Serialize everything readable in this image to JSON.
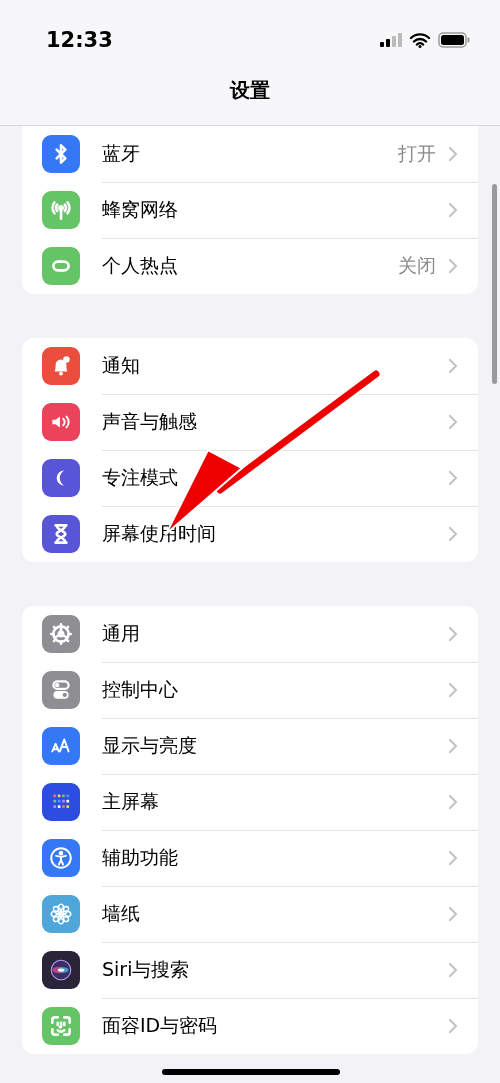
{
  "status_bar": {
    "time": "12:33"
  },
  "title": "设置",
  "sections": [
    {
      "rows": [
        {
          "label": "蓝牙",
          "value": "打开",
          "color": "#3478f6"
        },
        {
          "label": "蜂窝网络",
          "color": "#65c466"
        },
        {
          "label": "个人热点",
          "value": "关闭",
          "color": "#65c466"
        }
      ]
    },
    {
      "rows": [
        {
          "label": "通知",
          "color": "#eb4e3d"
        },
        {
          "label": "声音与触感",
          "color": "#eb445a"
        },
        {
          "label": "专注模式",
          "color": "#5856d6"
        },
        {
          "label": "屏幕使用时间",
          "color": "#5856d6"
        }
      ]
    },
    {
      "rows": [
        {
          "label": "通用",
          "color": "#8e8e93"
        },
        {
          "label": "控制中心",
          "color": "#8e8e93"
        },
        {
          "label": "显示与亮度",
          "color": "#3478f6"
        },
        {
          "label": "主屏幕",
          "color": "#2c4de0"
        },
        {
          "label": "辅助功能",
          "color": "#3478f6"
        },
        {
          "label": "墙纸",
          "color": "#4fa6d8"
        },
        {
          "label": "Siri与搜索",
          "color": "#2a2438"
        },
        {
          "label": "面容ID与密码",
          "color": "#65c466"
        }
      ]
    }
  ]
}
